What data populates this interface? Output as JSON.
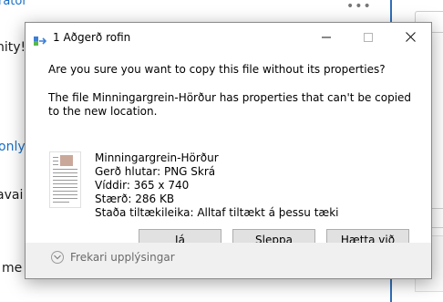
{
  "background": {
    "top_link": "rator",
    "unity_text": "nity!",
    "only_text": "only\"",
    "avai_text": "avai",
    "me_text": "me",
    "dots": "•••"
  },
  "dialog": {
    "title": "1 Aðgerð rofin",
    "question": "Are you sure you want to copy this file without its properties?",
    "info": "The file Minningargrein-Hörður has properties that can't be copied to the new location.",
    "file": {
      "name": "Minningargrein-Hörður",
      "type": "Gerð hlutar: PNG Skrá",
      "dimensions": "Víddir: 365 x 740",
      "size": "Stærð: 286 KB",
      "availability": "Staða tiltækileika: Alltaf tiltækt á þessu tæki"
    },
    "buttons": {
      "yes": "Já",
      "skip": "Sleppa",
      "cancel": "Hætta við"
    },
    "more_details": "Frekari upplýsingar"
  },
  "colors": {
    "accent": "#2f6fba",
    "link": "#1a6fc4",
    "dialog_bg": "#f0f0f0",
    "button_bg": "#e1e1e1"
  },
  "icons": {
    "app": "copy-move-icon",
    "minimize": "minimize-icon",
    "maximize": "maximize-icon",
    "close": "close-icon",
    "more": "chevron-down-icon"
  }
}
